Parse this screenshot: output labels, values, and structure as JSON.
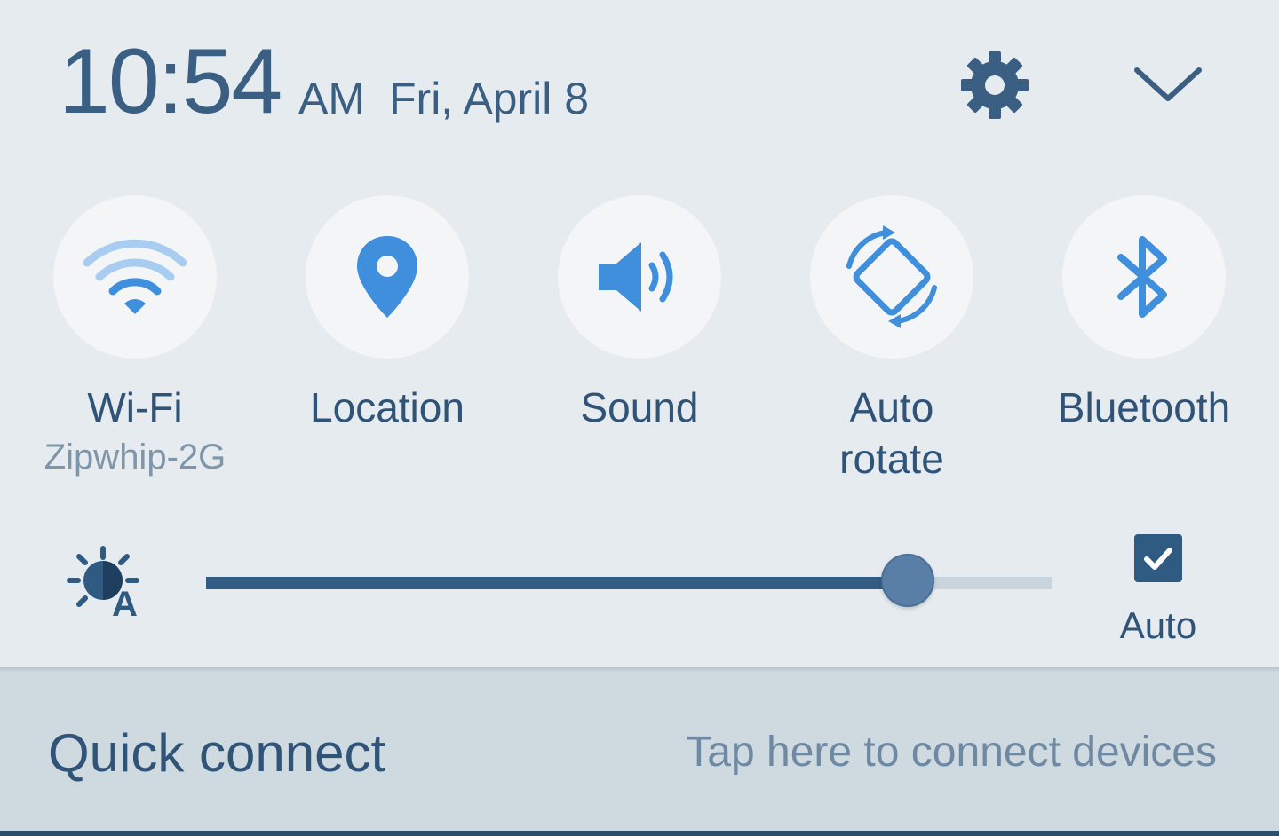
{
  "header": {
    "time": "10:54",
    "ampm": "AM",
    "date": "Fri, April 8",
    "settings_icon": "gear-icon",
    "collapse_icon": "chevron-down-icon"
  },
  "toggles": [
    {
      "id": "wifi",
      "label": "Wi-Fi",
      "sublabel": "Zipwhip-2G",
      "icon": "wifi-icon",
      "active": true
    },
    {
      "id": "location",
      "label": "Location",
      "sublabel": "",
      "icon": "location-pin-icon",
      "active": true
    },
    {
      "id": "sound",
      "label": "Sound",
      "sublabel": "",
      "icon": "volume-icon",
      "active": true
    },
    {
      "id": "auto-rotate",
      "label": "Auto\nrotate",
      "sublabel": "",
      "icon": "rotate-icon",
      "active": true
    },
    {
      "id": "bluetooth",
      "label": "Bluetooth",
      "sublabel": "",
      "icon": "bluetooth-icon",
      "active": true
    }
  ],
  "brightness": {
    "icon": "auto-brightness-icon",
    "level": 0.83,
    "auto_checked": true,
    "auto_label": "Auto"
  },
  "quick_connect": {
    "title": "Quick connect",
    "hint": "Tap here to connect devices"
  },
  "colors": {
    "accent": "#3f8fdc",
    "primary_text": "#2f5478",
    "secondary_text": "#7f95aa",
    "panel_bg": "#e6ebef",
    "slider_fill": "#325c83"
  }
}
